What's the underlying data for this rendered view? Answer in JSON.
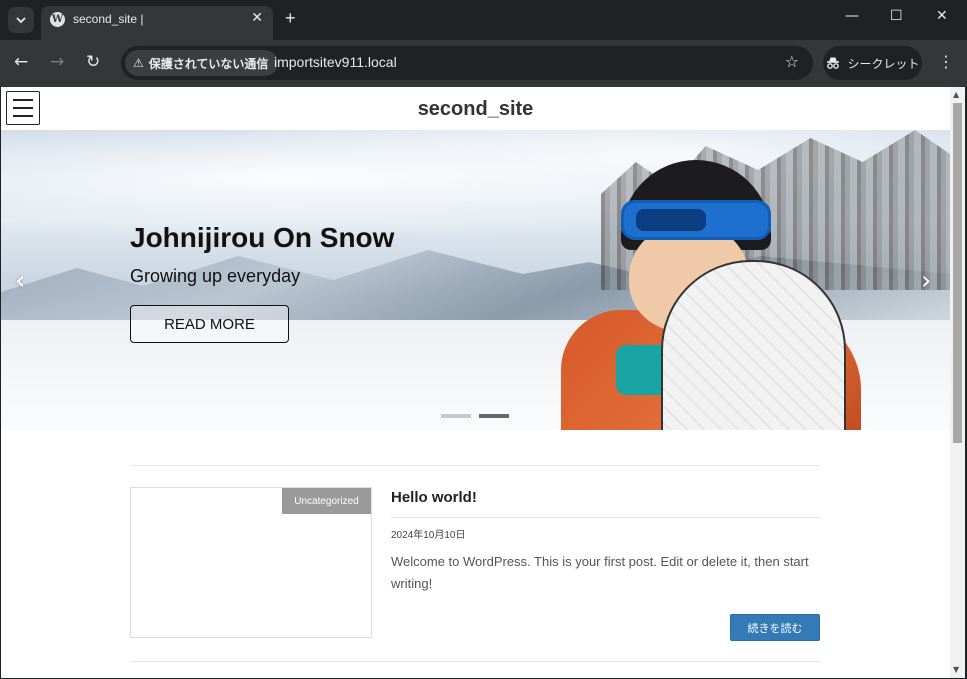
{
  "browser": {
    "tab_title": "second_site |",
    "tab_icon": "wordpress-icon",
    "new_tab_label": "+",
    "security_label": "保護されていない通信",
    "url": "importsitev911.local",
    "incognito_label": "シークレット"
  },
  "site": {
    "title": "second_site"
  },
  "hero": {
    "title": "Johnijirou On Snow",
    "subtitle": "Growing up everyday",
    "button_label": "READ MORE",
    "slide_count": 2,
    "active_slide": 2
  },
  "post": {
    "category": "Uncategorized",
    "title": "Hello world!",
    "date": "2024年10月10日",
    "excerpt": "Welcome to WordPress. This is your first post. Edit or delete it, then start writing!",
    "read_more_label": "続きを読む"
  },
  "colors": {
    "read_more_button": "#337ab7",
    "category_badge": "#9a9a9a",
    "browser_frame": "#202124"
  }
}
